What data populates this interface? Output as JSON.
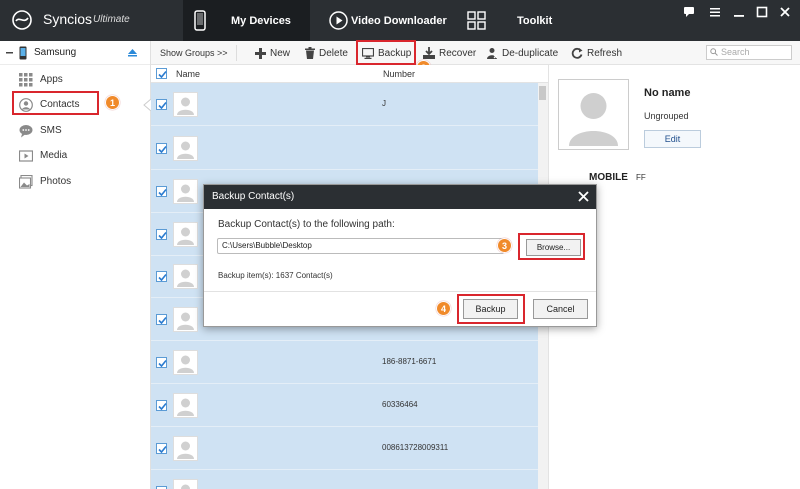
{
  "app": {
    "name": "Syncios",
    "edition": "Ultimate"
  },
  "nav": {
    "tabs": [
      {
        "label": "My Devices"
      },
      {
        "label": "Video Downloader"
      },
      {
        "label": "Toolkit"
      }
    ]
  },
  "sidebar": {
    "device": "Samsung",
    "items": [
      {
        "label": "Apps"
      },
      {
        "label": "Contacts"
      },
      {
        "label": "SMS"
      },
      {
        "label": "Media"
      },
      {
        "label": "Photos"
      }
    ]
  },
  "toolbar": {
    "show_groups": "Show Groups  >>",
    "new": "New",
    "delete": "Delete",
    "backup": "Backup",
    "recover": "Recover",
    "deduplicate": "De-duplicate",
    "refresh": "Refresh",
    "search_placeholder": "Search"
  },
  "list": {
    "headers": {
      "name": "Name",
      "number": "Number"
    },
    "rows": [
      {
        "number": "J"
      },
      {
        "number": ""
      },
      {
        "number": ""
      },
      {
        "number": ""
      },
      {
        "number": ""
      },
      {
        "number": ""
      },
      {
        "number": "186-8871-6671"
      },
      {
        "number": "60336464"
      },
      {
        "number": "008613728009311"
      },
      {
        "number": ""
      }
    ]
  },
  "detail": {
    "name": "No name",
    "group": "Ungrouped",
    "edit": "Edit",
    "phone_type": "MOBILE",
    "phone_value": "FF"
  },
  "dialog": {
    "title": "Backup Contact(s)",
    "prompt": "Backup Contact(s) to the following path:",
    "path": "C:\\Users\\Bubble\\Desktop",
    "browse": "Browse...",
    "info": "Backup item(s): 1637 Contact(s)",
    "backup": "Backup",
    "cancel": "Cancel"
  },
  "steps": [
    "1",
    "2",
    "3",
    "4"
  ],
  "colors": {
    "titlebar": "#2b2f33",
    "selection": "#cfe2f3",
    "highlight": "#d9262d",
    "step_badge": "#f08a2a"
  }
}
